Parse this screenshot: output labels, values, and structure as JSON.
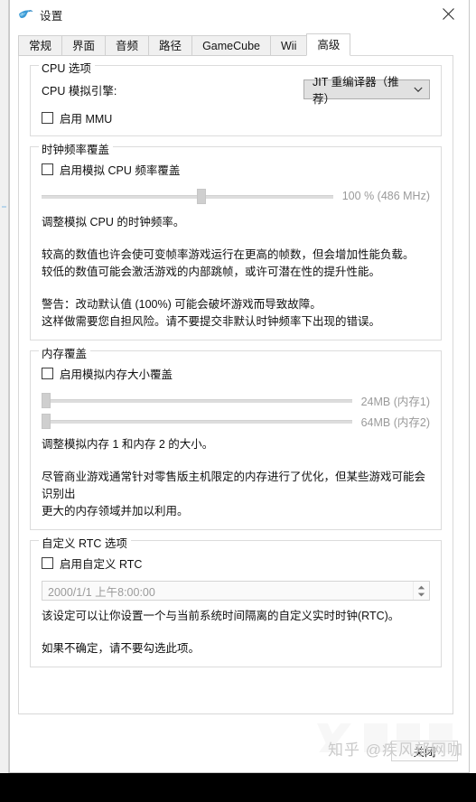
{
  "window": {
    "title": "设置",
    "icon": "dolphin-icon",
    "close_icon": "close-icon"
  },
  "tabs": [
    {
      "label": "常规",
      "active": false
    },
    {
      "label": "界面",
      "active": false
    },
    {
      "label": "音频",
      "active": false
    },
    {
      "label": "路径",
      "active": false
    },
    {
      "label": "GameCube",
      "active": false
    },
    {
      "label": "Wii",
      "active": false
    },
    {
      "label": "高级",
      "active": true
    }
  ],
  "cpu_options": {
    "legend": "CPU 选项",
    "engine_label": "CPU 模拟引擎:",
    "engine_value": "JIT 重编译器（推荐）",
    "mmu_checkbox_label": "启用 MMU",
    "mmu_checked": false
  },
  "clock_override": {
    "legend": "时钟频率覆盖",
    "enable_label": "启用模拟 CPU 频率覆盖",
    "enable_checked": false,
    "slider_percent": 55,
    "slider_value_label": "100 % (486 MHz)",
    "desc1": "调整模拟 CPU 的时钟频率。",
    "desc2_line1": "较高的数值也许会使可变帧率游戏运行在更高的帧数，但会增加性能负载。",
    "desc2_line2": "较低的数值可能会激活游戏的内部跳帧，或许可潜在性的提升性能。",
    "desc3_line1": "警告：改动默认值 (100%) 可能会破坏游戏而导致故障。",
    "desc3_line2": "这样做需要您自担风险。请不要提交非默认时钟频率下出现的错误。"
  },
  "memory_override": {
    "legend": "内存覆盖",
    "enable_label": "启用模拟内存大小覆盖",
    "enable_checked": false,
    "slider1_percent": 0,
    "slider1_value_label": "24MB (内存1)",
    "slider2_percent": 0,
    "slider2_value_label": "64MB (内存2)",
    "desc1": "调整模拟内存 1 和内存 2 的大小。",
    "desc2_line1": "尽管商业游戏通常针对零售版主机限定的内存进行了优化，但某些游戏可能会识别出",
    "desc2_line2": "更大的内存领域并加以利用。"
  },
  "rtc_options": {
    "legend": "自定义 RTC 选项",
    "enable_label": "启用自定义 RTC",
    "enable_checked": false,
    "datetime_value": "2000/1/1 上午8:00:00",
    "desc1": "该设定可以让你设置一个与当前系统时间隔离的自定义实时时钟(RTC)。",
    "desc2": "如果不确定，请不要勾选此项。"
  },
  "footer": {
    "close_label": "关闭"
  },
  "watermark": {
    "text": "知乎 @疾风邡网咖"
  },
  "colors": {
    "accent": "#2a8fd0",
    "window_bg": "#ffffff",
    "tab_inactive_bg": "#f0f0f0",
    "combo_bg": "#e1e1e1",
    "disabled_text": "#9a9a9a",
    "border": "#dcdcdc"
  }
}
